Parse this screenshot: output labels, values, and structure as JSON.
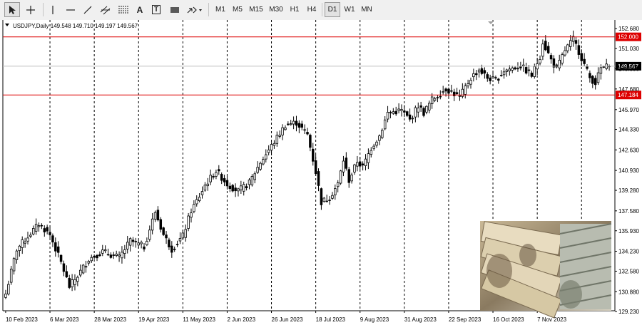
{
  "toolbar": {
    "tools": [
      "cursor-icon",
      "crosshair-icon",
      "vertical-line-icon",
      "horizontal-line-icon",
      "trendline-icon",
      "equidistant-channel-icon",
      "fibonacci-icon",
      "text-icon",
      "text-label-icon",
      "rectangle-icon",
      "arrows-icon"
    ],
    "text_tool_label": "A",
    "text_label_tool_label": "T",
    "timeframes": [
      "M1",
      "M5",
      "M15",
      "M30",
      "H1",
      "H4",
      "D1",
      "W1",
      "MN"
    ],
    "active_timeframe": "D1"
  },
  "chart": {
    "symbol_line": "USDJPY,Daily  149.548 149.710 149.197 149.567",
    "photo_description": "yen-and-dollar-banknotes-image"
  },
  "chart_data": {
    "type": "candlestick",
    "symbol": "USDJPY",
    "timeframe": "Daily",
    "ohlc_current": {
      "open": 149.548,
      "high": 149.71,
      "low": 149.197,
      "close": 149.567
    },
    "ylim": [
      129.3,
      153.4
    ],
    "y_ticks": [
      "152.680",
      "151.030",
      "149.350",
      "147.680",
      "145.970",
      "144.330",
      "142.630",
      "140.930",
      "139.280",
      "137.580",
      "135.930",
      "134.230",
      "132.580",
      "130.880",
      "129.230"
    ],
    "x_ticks": [
      "10 Feb 2023",
      "6 Mar 2023",
      "28 Mar 2023",
      "19 Apr 2023",
      "11 May 2023",
      "2 Jun 2023",
      "26 Jun 2023",
      "18 Jul 2023",
      "9 Aug 2023",
      "31 Aug 2023",
      "22 Sep 2023",
      "16 Oct 2023",
      "7 Nov 2023"
    ],
    "levels": [
      {
        "value": 152.0,
        "label": "152.000",
        "color": "#dd0000"
      },
      {
        "value": 147.184,
        "label": "147.184",
        "color": "#dd0000"
      }
    ],
    "current_price": {
      "value": 149.567,
      "label": "149.567"
    },
    "grid": "vertical-dashed",
    "colors": {
      "candle": "#000000",
      "level": "#dd0000"
    },
    "anchors": [
      [
        0,
        130.7
      ],
      [
        4,
        134.4
      ],
      [
        12,
        136.5
      ],
      [
        16,
        135.6
      ],
      [
        20,
        133.3
      ],
      [
        23,
        131.3
      ],
      [
        26,
        132.2
      ],
      [
        30,
        133.6
      ],
      [
        35,
        134.2
      ],
      [
        41,
        133.7
      ],
      [
        45,
        135.1
      ],
      [
        50,
        134.6
      ],
      [
        54,
        137.5
      ],
      [
        57,
        135.6
      ],
      [
        60,
        134.4
      ],
      [
        64,
        135.5
      ],
      [
        67,
        137.6
      ],
      [
        70,
        138.8
      ],
      [
        72,
        139.7
      ],
      [
        76,
        140.9
      ],
      [
        80,
        139.8
      ],
      [
        84,
        139.2
      ],
      [
        88,
        139.9
      ],
      [
        92,
        141.6
      ],
      [
        97,
        143.3
      ],
      [
        101,
        144.7
      ],
      [
        105,
        144.9
      ],
      [
        109,
        143.9
      ],
      [
        112,
        140.8
      ],
      [
        114,
        138.3
      ],
      [
        117,
        138.7
      ],
      [
        120,
        139.8
      ],
      [
        122,
        141.8
      ],
      [
        124,
        140.1
      ],
      [
        127,
        141.7
      ],
      [
        129,
        141.2
      ],
      [
        132,
        142.8
      ],
      [
        135,
        143.8
      ],
      [
        138,
        145.7
      ],
      [
        143,
        145.9
      ],
      [
        146,
        145.1
      ],
      [
        149,
        146.3
      ],
      [
        151,
        145.7
      ],
      [
        154,
        146.8
      ],
      [
        159,
        147.7
      ],
      [
        164,
        147.0
      ],
      [
        168,
        148.6
      ],
      [
        171,
        149.3
      ],
      [
        174,
        148.6
      ],
      [
        177,
        148.4
      ],
      [
        180,
        149.2
      ],
      [
        186,
        149.6
      ],
      [
        190,
        148.8
      ],
      [
        193,
        150.4
      ],
      [
        194,
        151.6
      ],
      [
        197,
        150.1
      ],
      [
        199,
        149.3
      ],
      [
        202,
        150.9
      ],
      [
        205,
        151.8
      ],
      [
        207,
        150.8
      ],
      [
        209,
        149.7
      ],
      [
        211,
        148.6
      ],
      [
        213,
        148.2
      ],
      [
        215,
        149.4
      ],
      [
        218,
        149.567
      ]
    ]
  }
}
